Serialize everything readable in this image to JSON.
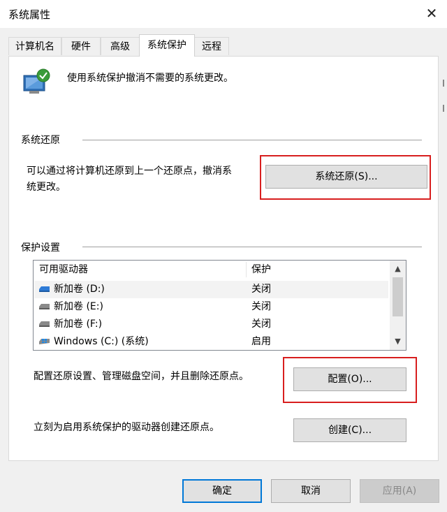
{
  "window": {
    "title": "系统属性",
    "close_glyph": "✕"
  },
  "tabs": [
    {
      "label": "计算机名"
    },
    {
      "label": "硬件"
    },
    {
      "label": "高级"
    },
    {
      "label": "系统保护"
    },
    {
      "label": "远程"
    }
  ],
  "intro": {
    "text": "使用系统保护撤消不需要的系统更改。",
    "icon": "system-protection-icon"
  },
  "restore_group": {
    "title": "系统还原",
    "description_line1": "可以通过将计算机还原到上一个还原点，撤消系",
    "description_line2": "统更改。",
    "button_label": "系统还原(S)..."
  },
  "protection_group": {
    "title": "保护设置",
    "columns": {
      "drive": "可用驱动器",
      "protection": "保护"
    },
    "drives": [
      {
        "name": "新加卷 (D:)",
        "status": "关闭",
        "icon": "drive-icon"
      },
      {
        "name": "新加卷 (E:)",
        "status": "关闭",
        "icon": "drive-icon"
      },
      {
        "name": "新加卷 (F:)",
        "status": "关闭",
        "icon": "drive-icon"
      },
      {
        "name": "Windows (C:) (系统)",
        "status": "启用",
        "icon": "windows-drive-icon"
      }
    ],
    "configure_text": "配置还原设置、管理磁盘空间，并且删除还原点。",
    "configure_button": "配置(O)...",
    "create_text": "立刻为启用系统保护的驱动器创建还原点。",
    "create_button": "创建(C)..."
  },
  "footer": {
    "ok": "确定",
    "cancel": "取消",
    "apply": "应用(A)"
  },
  "colors": {
    "highlight": "#d81e1e",
    "accent": "#0078d7"
  }
}
